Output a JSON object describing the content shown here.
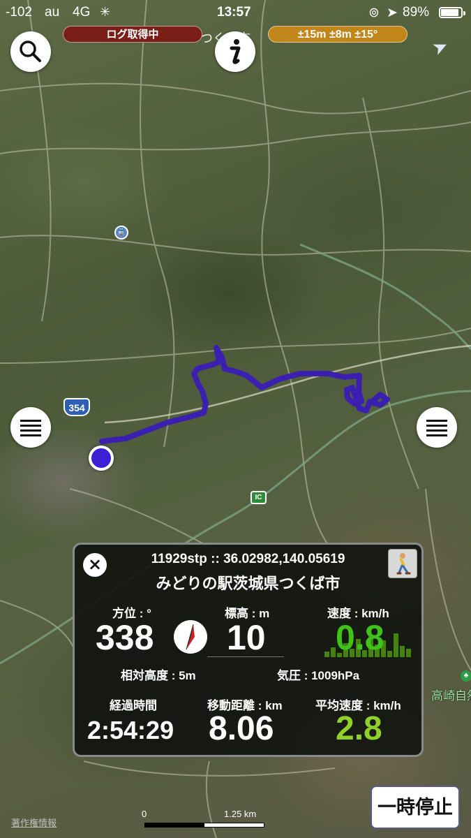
{
  "status_bar": {
    "signal": "-102",
    "carrier": "au",
    "network": "4G",
    "time": "13:57",
    "battery": "89%"
  },
  "header": {
    "logging_status": "ログ取得中",
    "accuracy": "±15m ±8m ±15°",
    "under_label": "つくば市"
  },
  "map": {
    "route_badge": "354",
    "ic_badge": "IC",
    "park_label": "高崎自然",
    "copyright": "著作権情報",
    "scale_start": "0",
    "scale_end": "1.25 km",
    "route_color": "#3a1fb0"
  },
  "panel": {
    "close_icon": "close-icon",
    "coords": "11929stp :: 36.02982,140.05619",
    "place": "みどりの駅茨城県つくば市",
    "heading_label": "方位 : °",
    "heading_value": "338",
    "altitude_label": "標高 : m",
    "altitude_value": "10",
    "speed_label": "速度 : km/h",
    "speed_value": "0.8",
    "relative_altitude": "相対高度 : 5m",
    "pressure": "気圧 : 1009hPa",
    "elapsed_label": "経過時間",
    "elapsed_value": "2:54:29",
    "distance_label": "移動距離 : km",
    "distance_value": "8.06",
    "avg_speed_label": "平均速度 : km/h",
    "avg_speed_value": "2.8",
    "speed_color": "#3fc21a",
    "avg_speed_color": "#8fd12a"
  },
  "pause_button": "一時停止"
}
